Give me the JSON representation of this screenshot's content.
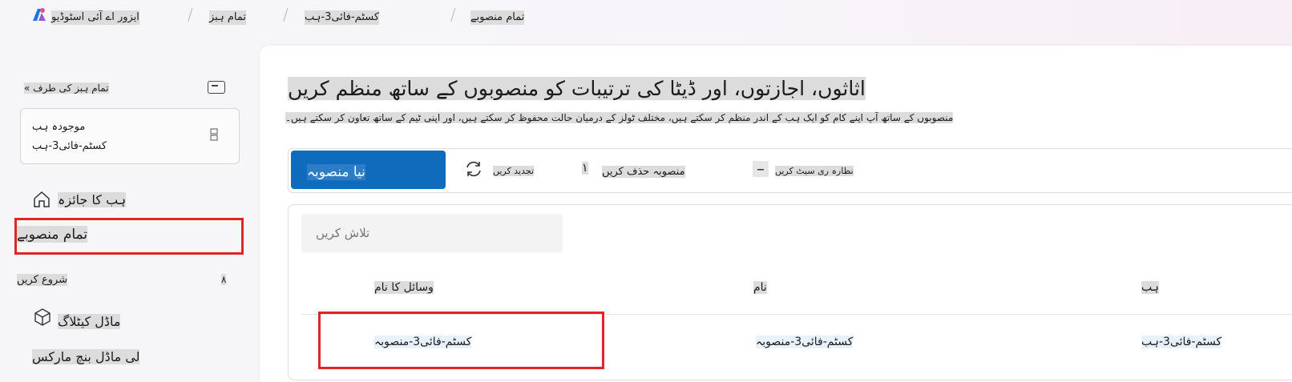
{
  "breadcrumb": {
    "items": [
      "ایزور اے آئی اسٹوڈیو",
      "تمام ہبز",
      "کسٹم-فائی3-ہب",
      "تمام منصوبے"
    ]
  },
  "sidebar": {
    "back_label": "« تمام ہبز کی طرف",
    "hub_card": {
      "label": "موجودہ ہب",
      "value": "کسٹم-فائی3-ہب"
    },
    "nav": {
      "overview": "ہب کا جائزہ",
      "all_projects": "تمام منصوبے",
      "section_start": "شروع کریں",
      "section_chevron": "۸",
      "model_catalog": "ماڈل کیٹلاگ",
      "model_benchmarks": "لی ماڈل بنچ مارکس"
    }
  },
  "main": {
    "title": "اثاثوں، اجازتوں، اور ڈیٹا کی ترتیبات کو منصوبوں کے ساتھ منظم کریں",
    "subtitle": "منصوبوں کے ساتھ آپ اپنے کام کو ایک ہب کے اندر منظم کر سکتے ہیں، مختلف ٹولز کے درمیان حالت محفوظ کر سکتے ہیں، اور اپنی ٹیم کے ساتھ تعاون کر سکتے ہیں۔",
    "toolbar": {
      "new_project": "نیا منصوبہ",
      "new_project_glyph": "",
      "refresh": "تجدید کریں",
      "delete_glyph": "۱",
      "delete": "منصوبہ حذف کریں",
      "reset_view": "نظارہ ری سیٹ کریں"
    },
    "search": {
      "placeholder": "تلاش کریں"
    },
    "table": {
      "columns": [
        "وسائل کا نام",
        "نام",
        "ہب"
      ],
      "rows": [
        [
          "کسٹم-فائی3-منصوبہ",
          "کسٹم-فائی3-منصوبہ",
          "کسٹم-فائی3-ہب"
        ]
      ]
    }
  },
  "colors": {
    "accent": "#0f6cbd",
    "highlight_box": "#e0242b"
  }
}
